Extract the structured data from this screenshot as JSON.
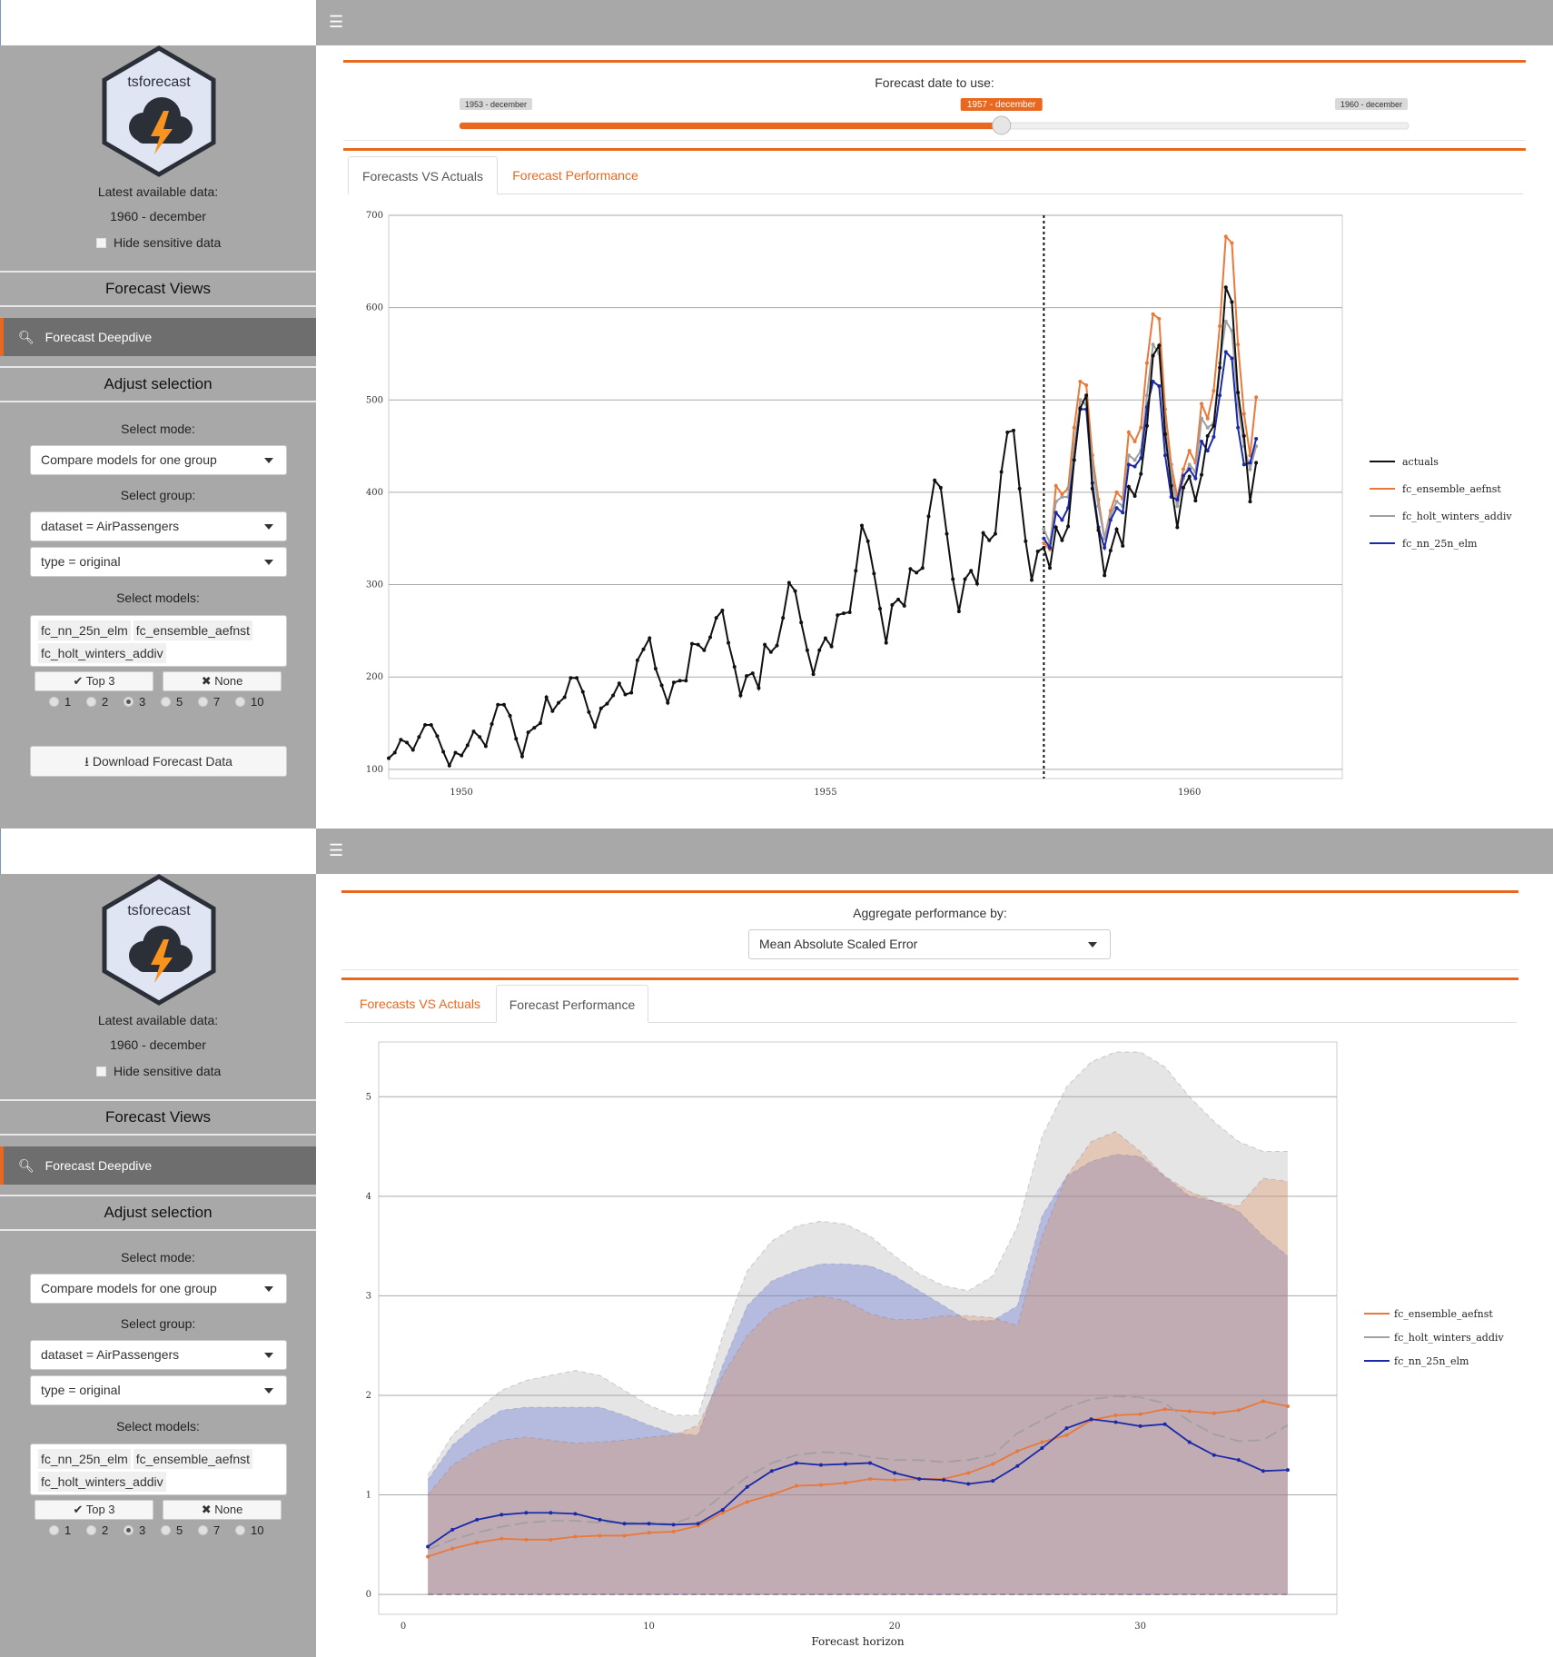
{
  "app": {
    "logo_text": "tsforecast",
    "latest_label": "Latest available data:",
    "latest_value": "1960 - december",
    "hide_sensitive": "Hide sensitive data",
    "menu_icon": "hamburger-icon"
  },
  "sidebar": {
    "forecast_views": "Forecast Views",
    "nav_item": "Forecast Deepdive",
    "adjust_selection": "Adjust selection",
    "select_mode_label": "Select mode:",
    "select_mode_value": "Compare models for one group",
    "select_group_label": "Select group:",
    "group_dataset_value": "dataset = AirPassengers",
    "group_type_value": "type = original",
    "select_models_label": "Select models:",
    "models": [
      "fc_nn_25n_elm",
      "fc_ensemble_aefnst",
      "fc_holt_winters_addiv"
    ],
    "top3_label": "Top 3",
    "none_label": "None",
    "radio_options": [
      "1",
      "2",
      "3",
      "5",
      "7",
      "10"
    ],
    "radio_selected": "3",
    "download_label": "Download Forecast Data"
  },
  "panel1": {
    "slider_label": "Forecast date to use:",
    "slider_min": "1953 - december",
    "slider_value": "1957 - december",
    "slider_max": "1960 - december",
    "slider_fraction": 0.571,
    "tabs": [
      "Forecasts VS Actuals",
      "Forecast Performance"
    ],
    "active_tab": 0
  },
  "panel2": {
    "aggregate_label": "Aggregate performance by:",
    "aggregate_value": "Mean Absolute Scaled Error",
    "tabs": [
      "Forecasts VS Actuals",
      "Forecast Performance"
    ],
    "active_tab": 1
  },
  "colors": {
    "accent": "#e8681f",
    "sidebar": "#a8a8a8",
    "actuals": "#111111",
    "ensemble": "#e8793a",
    "holt": "#a0a0a0",
    "nn": "#1a2aa8"
  },
  "chart_data": [
    {
      "type": "line",
      "title": "",
      "xlabel": "",
      "ylabel": "",
      "ylim": [
        90,
        700
      ],
      "xlim": [
        1949.0,
        1962.1
      ],
      "yticks": [
        100,
        200,
        300,
        400,
        500,
        600,
        700
      ],
      "xticks": [
        1950,
        1955,
        1960
      ],
      "forecast_date": 1958.0,
      "legend_position": "right",
      "x_start": 1949.0,
      "series": [
        {
          "name": "actuals",
          "color": "#111111",
          "values": [
            112,
            118,
            132,
            129,
            121,
            135,
            148,
            148,
            136,
            119,
            104,
            118,
            115,
            126,
            141,
            135,
            125,
            149,
            170,
            170,
            158,
            133,
            114,
            140,
            145,
            150,
            178,
            163,
            172,
            178,
            199,
            199,
            184,
            162,
            146,
            166,
            171,
            180,
            193,
            181,
            183,
            218,
            230,
            242,
            209,
            191,
            172,
            194,
            196,
            196,
            236,
            235,
            229,
            243,
            264,
            272,
            237,
            211,
            180,
            201,
            204,
            188,
            235,
            227,
            234,
            264,
            302,
            293,
            259,
            229,
            203,
            229,
            242,
            233,
            267,
            269,
            270,
            315,
            364,
            347,
            312,
            274,
            237,
            278,
            284,
            277,
            317,
            313,
            318,
            374,
            413,
            405,
            355,
            306,
            271,
            306,
            315,
            301,
            356,
            348,
            355,
            422,
            465,
            467,
            404,
            347,
            305,
            336,
            340,
            318,
            362,
            348,
            363,
            435,
            491,
            505,
            404,
            359,
            310,
            337,
            360,
            342,
            406,
            396,
            420,
            472,
            548,
            559,
            463,
            407,
            362,
            405,
            417,
            391,
            419,
            461,
            472,
            535,
            622,
            606,
            508,
            461,
            390,
            432
          ]
        },
        {
          "name": "fc_ensemble_aefnst",
          "color": "#e8793a",
          "x_start": 1958.0,
          "values": [
            345,
            338,
            407,
            398,
            404,
            470,
            520,
            516,
            440,
            392,
            350,
            380,
            400,
            393,
            465,
            455,
            470,
            540,
            593,
            588,
            490,
            430,
            395,
            425,
            445,
            432,
            496,
            480,
            510,
            580,
            677,
            670,
            560,
            485,
            440,
            503
          ]
        },
        {
          "name": "fc_holt_winters_addiv",
          "color": "#a0a0a0",
          "x_start": 1958.0,
          "values": [
            360,
            345,
            390,
            395,
            395,
            450,
            500,
            495,
            430,
            385,
            350,
            375,
            390,
            385,
            440,
            435,
            445,
            505,
            560,
            550,
            470,
            420,
            385,
            415,
            430,
            422,
            480,
            470,
            475,
            540,
            585,
            575,
            495,
            450,
            425,
            450
          ]
        },
        {
          "name": "fc_nn_25n_elm",
          "color": "#1a2aa8",
          "x_start": 1958.0,
          "values": [
            350,
            340,
            378,
            370,
            383,
            435,
            490,
            490,
            410,
            362,
            340,
            370,
            383,
            378,
            430,
            428,
            437,
            492,
            520,
            515,
            440,
            395,
            392,
            418,
            425,
            415,
            455,
            445,
            460,
            505,
            552,
            545,
            470,
            430,
            432,
            458
          ]
        }
      ]
    },
    {
      "type": "area",
      "title": "",
      "xlabel": "Forecast horizon",
      "ylabel": "",
      "xlim": [
        -1,
        38
      ],
      "ylim": [
        -0.2,
        5.55
      ],
      "yticks": [
        0,
        1,
        2,
        3,
        4,
        5
      ],
      "xticks": [
        0,
        10,
        20,
        30
      ],
      "legend_position": "right",
      "x": [
        1,
        2,
        3,
        4,
        5,
        6,
        7,
        8,
        9,
        10,
        11,
        12,
        13,
        14,
        15,
        16,
        17,
        18,
        19,
        20,
        21,
        22,
        23,
        24,
        25,
        26,
        27,
        28,
        29,
        30,
        31,
        32,
        33,
        34,
        35,
        36
      ],
      "series": [
        {
          "name": "fc_ensemble_aefnst",
          "color": "#e8793a",
          "values": [
            0.38,
            0.46,
            0.52,
            0.56,
            0.55,
            0.55,
            0.58,
            0.59,
            0.59,
            0.62,
            0.63,
            0.69,
            0.82,
            0.93,
            1.0,
            1.09,
            1.1,
            1.12,
            1.16,
            1.15,
            1.16,
            1.16,
            1.22,
            1.31,
            1.44,
            1.53,
            1.6,
            1.75,
            1.8,
            1.81,
            1.86,
            1.84,
            1.82,
            1.85,
            1.94,
            1.89
          ],
          "band": [
            1.0,
            1.3,
            1.45,
            1.55,
            1.58,
            1.55,
            1.52,
            1.53,
            1.55,
            1.58,
            1.6,
            1.7,
            2.2,
            2.6,
            2.85,
            2.95,
            3.0,
            2.95,
            2.82,
            2.76,
            2.76,
            2.8,
            2.8,
            2.78,
            2.7,
            3.6,
            4.2,
            4.55,
            4.65,
            4.45,
            4.2,
            4.05,
            3.95,
            3.9,
            4.18,
            4.15
          ]
        },
        {
          "name": "fc_holt_winters_addiv",
          "color": "#a0a0a0",
          "values": [
            0.45,
            0.55,
            0.62,
            0.68,
            0.72,
            0.74,
            0.74,
            0.72,
            0.72,
            0.72,
            0.71,
            0.8,
            1.0,
            1.18,
            1.32,
            1.4,
            1.43,
            1.42,
            1.38,
            1.35,
            1.35,
            1.33,
            1.35,
            1.4,
            1.62,
            1.75,
            1.88,
            1.96,
            1.99,
            1.98,
            1.92,
            1.74,
            1.61,
            1.54,
            1.55,
            1.7
          ],
          "band": [
            1.2,
            1.6,
            1.85,
            2.05,
            2.15,
            2.2,
            2.25,
            2.2,
            2.05,
            1.9,
            1.8,
            1.8,
            2.6,
            3.25,
            3.55,
            3.7,
            3.75,
            3.72,
            3.6,
            3.4,
            3.22,
            3.1,
            3.05,
            3.2,
            3.7,
            4.6,
            5.1,
            5.35,
            5.45,
            5.45,
            5.3,
            5.0,
            4.75,
            4.55,
            4.45,
            4.45
          ]
        },
        {
          "name": "fc_nn_25n_elm",
          "color": "#1a2aa8",
          "values": [
            0.48,
            0.65,
            0.75,
            0.8,
            0.82,
            0.82,
            0.81,
            0.75,
            0.71,
            0.71,
            0.7,
            0.71,
            0.85,
            1.08,
            1.24,
            1.32,
            1.3,
            1.31,
            1.32,
            1.22,
            1.16,
            1.15,
            1.11,
            1.14,
            1.29,
            1.47,
            1.67,
            1.76,
            1.73,
            1.69,
            1.71,
            1.53,
            1.4,
            1.35,
            1.24,
            1.25
          ],
          "band": [
            1.15,
            1.5,
            1.7,
            1.85,
            1.88,
            1.88,
            1.88,
            1.88,
            1.8,
            1.7,
            1.62,
            1.6,
            2.3,
            2.9,
            3.15,
            3.25,
            3.32,
            3.32,
            3.3,
            3.2,
            3.05,
            2.9,
            2.75,
            2.75,
            2.9,
            3.8,
            4.2,
            4.35,
            4.42,
            4.4,
            4.2,
            4.0,
            3.95,
            3.85,
            3.6,
            3.4
          ]
        }
      ]
    }
  ]
}
